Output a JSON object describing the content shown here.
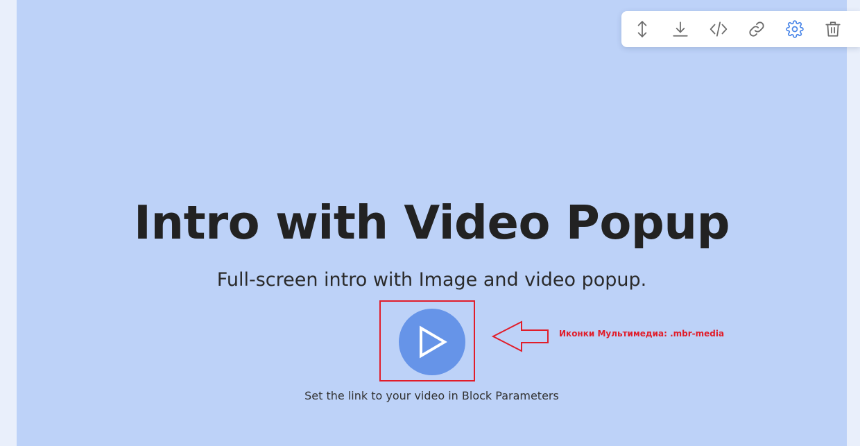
{
  "toolbar": {
    "items": [
      {
        "name": "move-icon",
        "label": "Move"
      },
      {
        "name": "download-icon",
        "label": "Download"
      },
      {
        "name": "code-icon",
        "label": "Code"
      },
      {
        "name": "link-icon",
        "label": "Link"
      },
      {
        "name": "gear-icon",
        "label": "Block Parameters"
      },
      {
        "name": "trash-icon",
        "label": "Delete"
      }
    ],
    "icon_color": "#6b6b6b",
    "active_icon_color": "#4a86e8"
  },
  "hero": {
    "title": "Intro with Video Popup",
    "subtitle": "Full-screen intro with Image and video popup.",
    "caption": "Set the link to your video in Block Parameters",
    "play_icon": "play-icon",
    "background_color": "#bdd2f8",
    "play_color": "#6694e8"
  },
  "annotation": {
    "text": "Иконки Мультимедиа: .mbr-media",
    "color": "#e11d2a"
  }
}
